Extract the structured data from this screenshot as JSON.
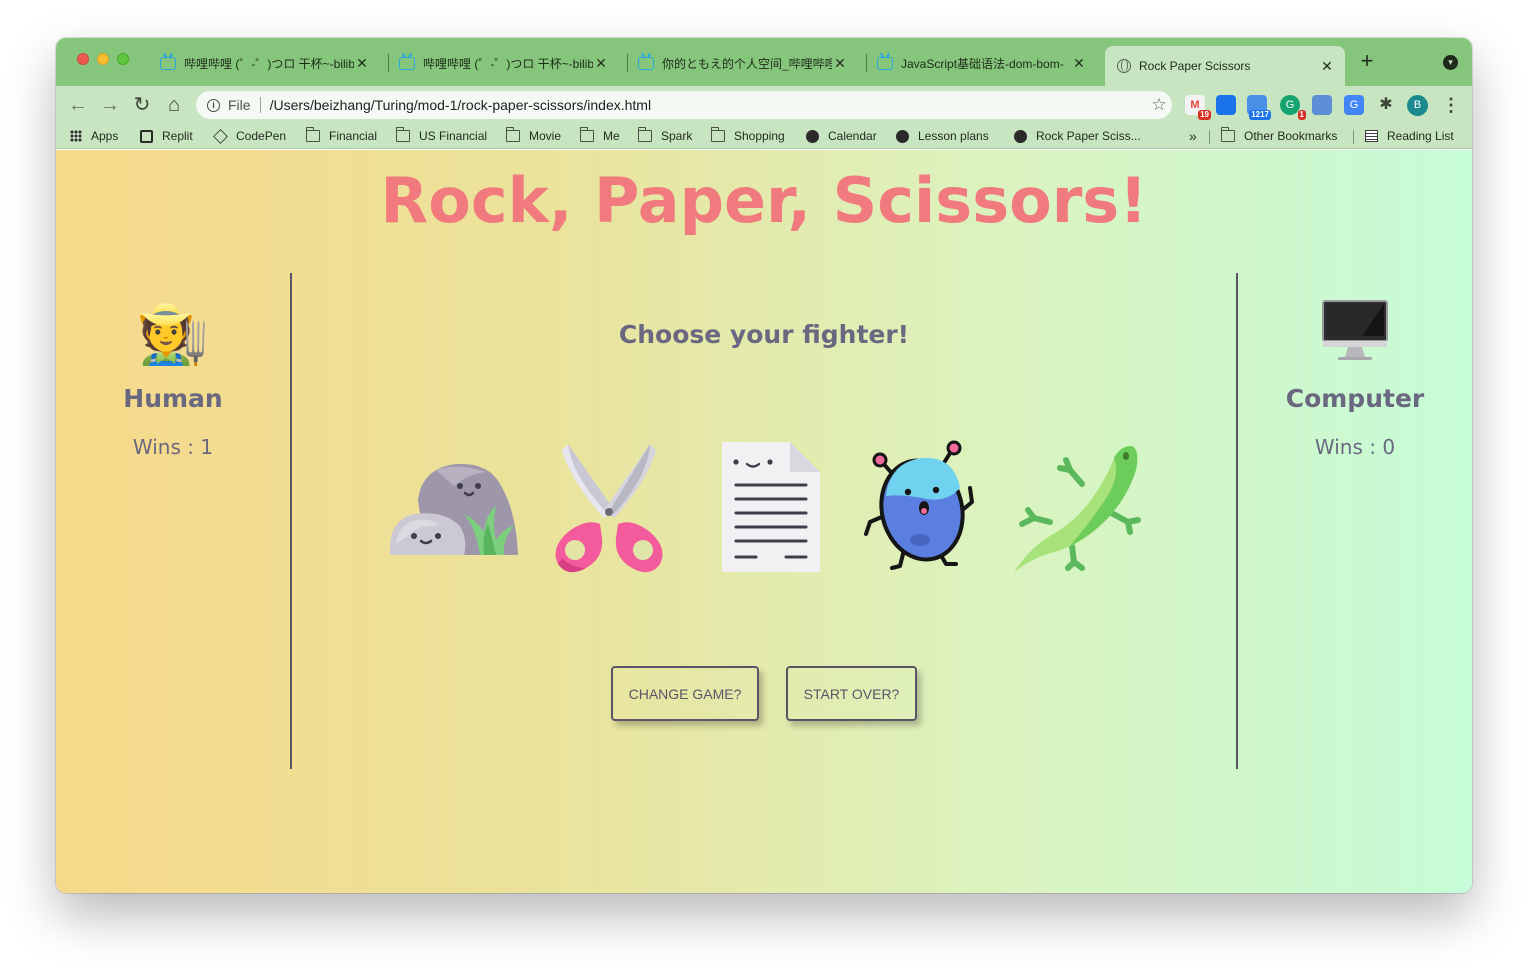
{
  "browser": {
    "tabs": [
      {
        "title": "哔哩哔哩 (゜-゜)つロ 干杯~-bilibili",
        "icon": "bilibili-icon",
        "active": false
      },
      {
        "title": "哔哩哔哩 (゜-゜)つロ 干杯~-bilibili",
        "icon": "bilibili-icon",
        "active": false
      },
      {
        "title": "你的ともえ的个人空间_哔哩哔哩",
        "icon": "bilibili-icon",
        "active": false
      },
      {
        "title": "JavaScript基础语法-dom-bom-",
        "icon": "bilibili-icon",
        "active": false
      },
      {
        "title": "Rock Paper Scissors",
        "icon": "globe-icon",
        "active": true
      }
    ],
    "new_tab_symbol": "+",
    "toolbar": {
      "back": "←",
      "forward": "→",
      "reload": "↻",
      "home": "⌂",
      "scheme": "File",
      "url": "/Users/beizhang/Turing/mod-1/rock-paper-scissors/index.html",
      "star": "☆",
      "extensions": [
        {
          "name": "gmail-extension-icon",
          "badge": "19",
          "color": "#e8453c"
        },
        {
          "name": "calendar-extension-icon",
          "badge": "",
          "color": "#1a73e8"
        },
        {
          "name": "counter-extension-icon",
          "badge": "1217",
          "color": "#4a8fe7"
        },
        {
          "name": "grammarly-extension-icon",
          "badge": "1",
          "color": "#15a36f"
        },
        {
          "name": "image-extension-icon",
          "badge": "",
          "color": "#5c8fd6"
        },
        {
          "name": "translate-extension-icon",
          "badge": "",
          "color": "#4285f4"
        },
        {
          "name": "puzzle-extension-icon",
          "badge": "",
          "color": "#3b4538"
        }
      ],
      "profile_initial": "B",
      "menu": "⋮"
    },
    "bookmarks": [
      {
        "label": "Apps",
        "icon": "apps-icon"
      },
      {
        "label": "Replit",
        "icon": "replit-icon"
      },
      {
        "label": "CodePen",
        "icon": "codepen-icon"
      },
      {
        "label": "Financial",
        "icon": "folder-icon"
      },
      {
        "label": "US Financial",
        "icon": "folder-icon"
      },
      {
        "label": "Movie",
        "icon": "folder-icon"
      },
      {
        "label": "Me",
        "icon": "folder-icon"
      },
      {
        "label": "Spark",
        "icon": "folder-icon"
      },
      {
        "label": "Shopping",
        "icon": "folder-icon"
      },
      {
        "label": "Calendar",
        "icon": "dark-circle-icon"
      },
      {
        "label": "Lesson plans",
        "icon": "dark-circle-icon"
      },
      {
        "label": "Rock Paper Sciss...",
        "icon": "dark-circle-icon"
      }
    ],
    "bookmarks_overflow": "»",
    "other_bookmarks": "Other Bookmarks",
    "reading_list": "Reading List"
  },
  "game": {
    "title": "Rock, Paper, Scissors!",
    "prompt": "Choose your fighter!",
    "human": {
      "avatar": "🧑‍🌾",
      "name": "Human",
      "wins_label": "Wins : 1"
    },
    "computer": {
      "avatar": "🖥️",
      "name": "Computer",
      "wins_label": "Wins : 0"
    },
    "fighters": [
      "rock",
      "scissors",
      "paper",
      "alien",
      "lizard"
    ],
    "buttons": {
      "change_game": "CHANGE GAME?",
      "start_over": "START OVER?"
    },
    "colors": {
      "title": "#f07a7e",
      "text": "#6a6880",
      "gradient_start": "#f7d98a",
      "gradient_end": "#c6fcd8"
    }
  }
}
